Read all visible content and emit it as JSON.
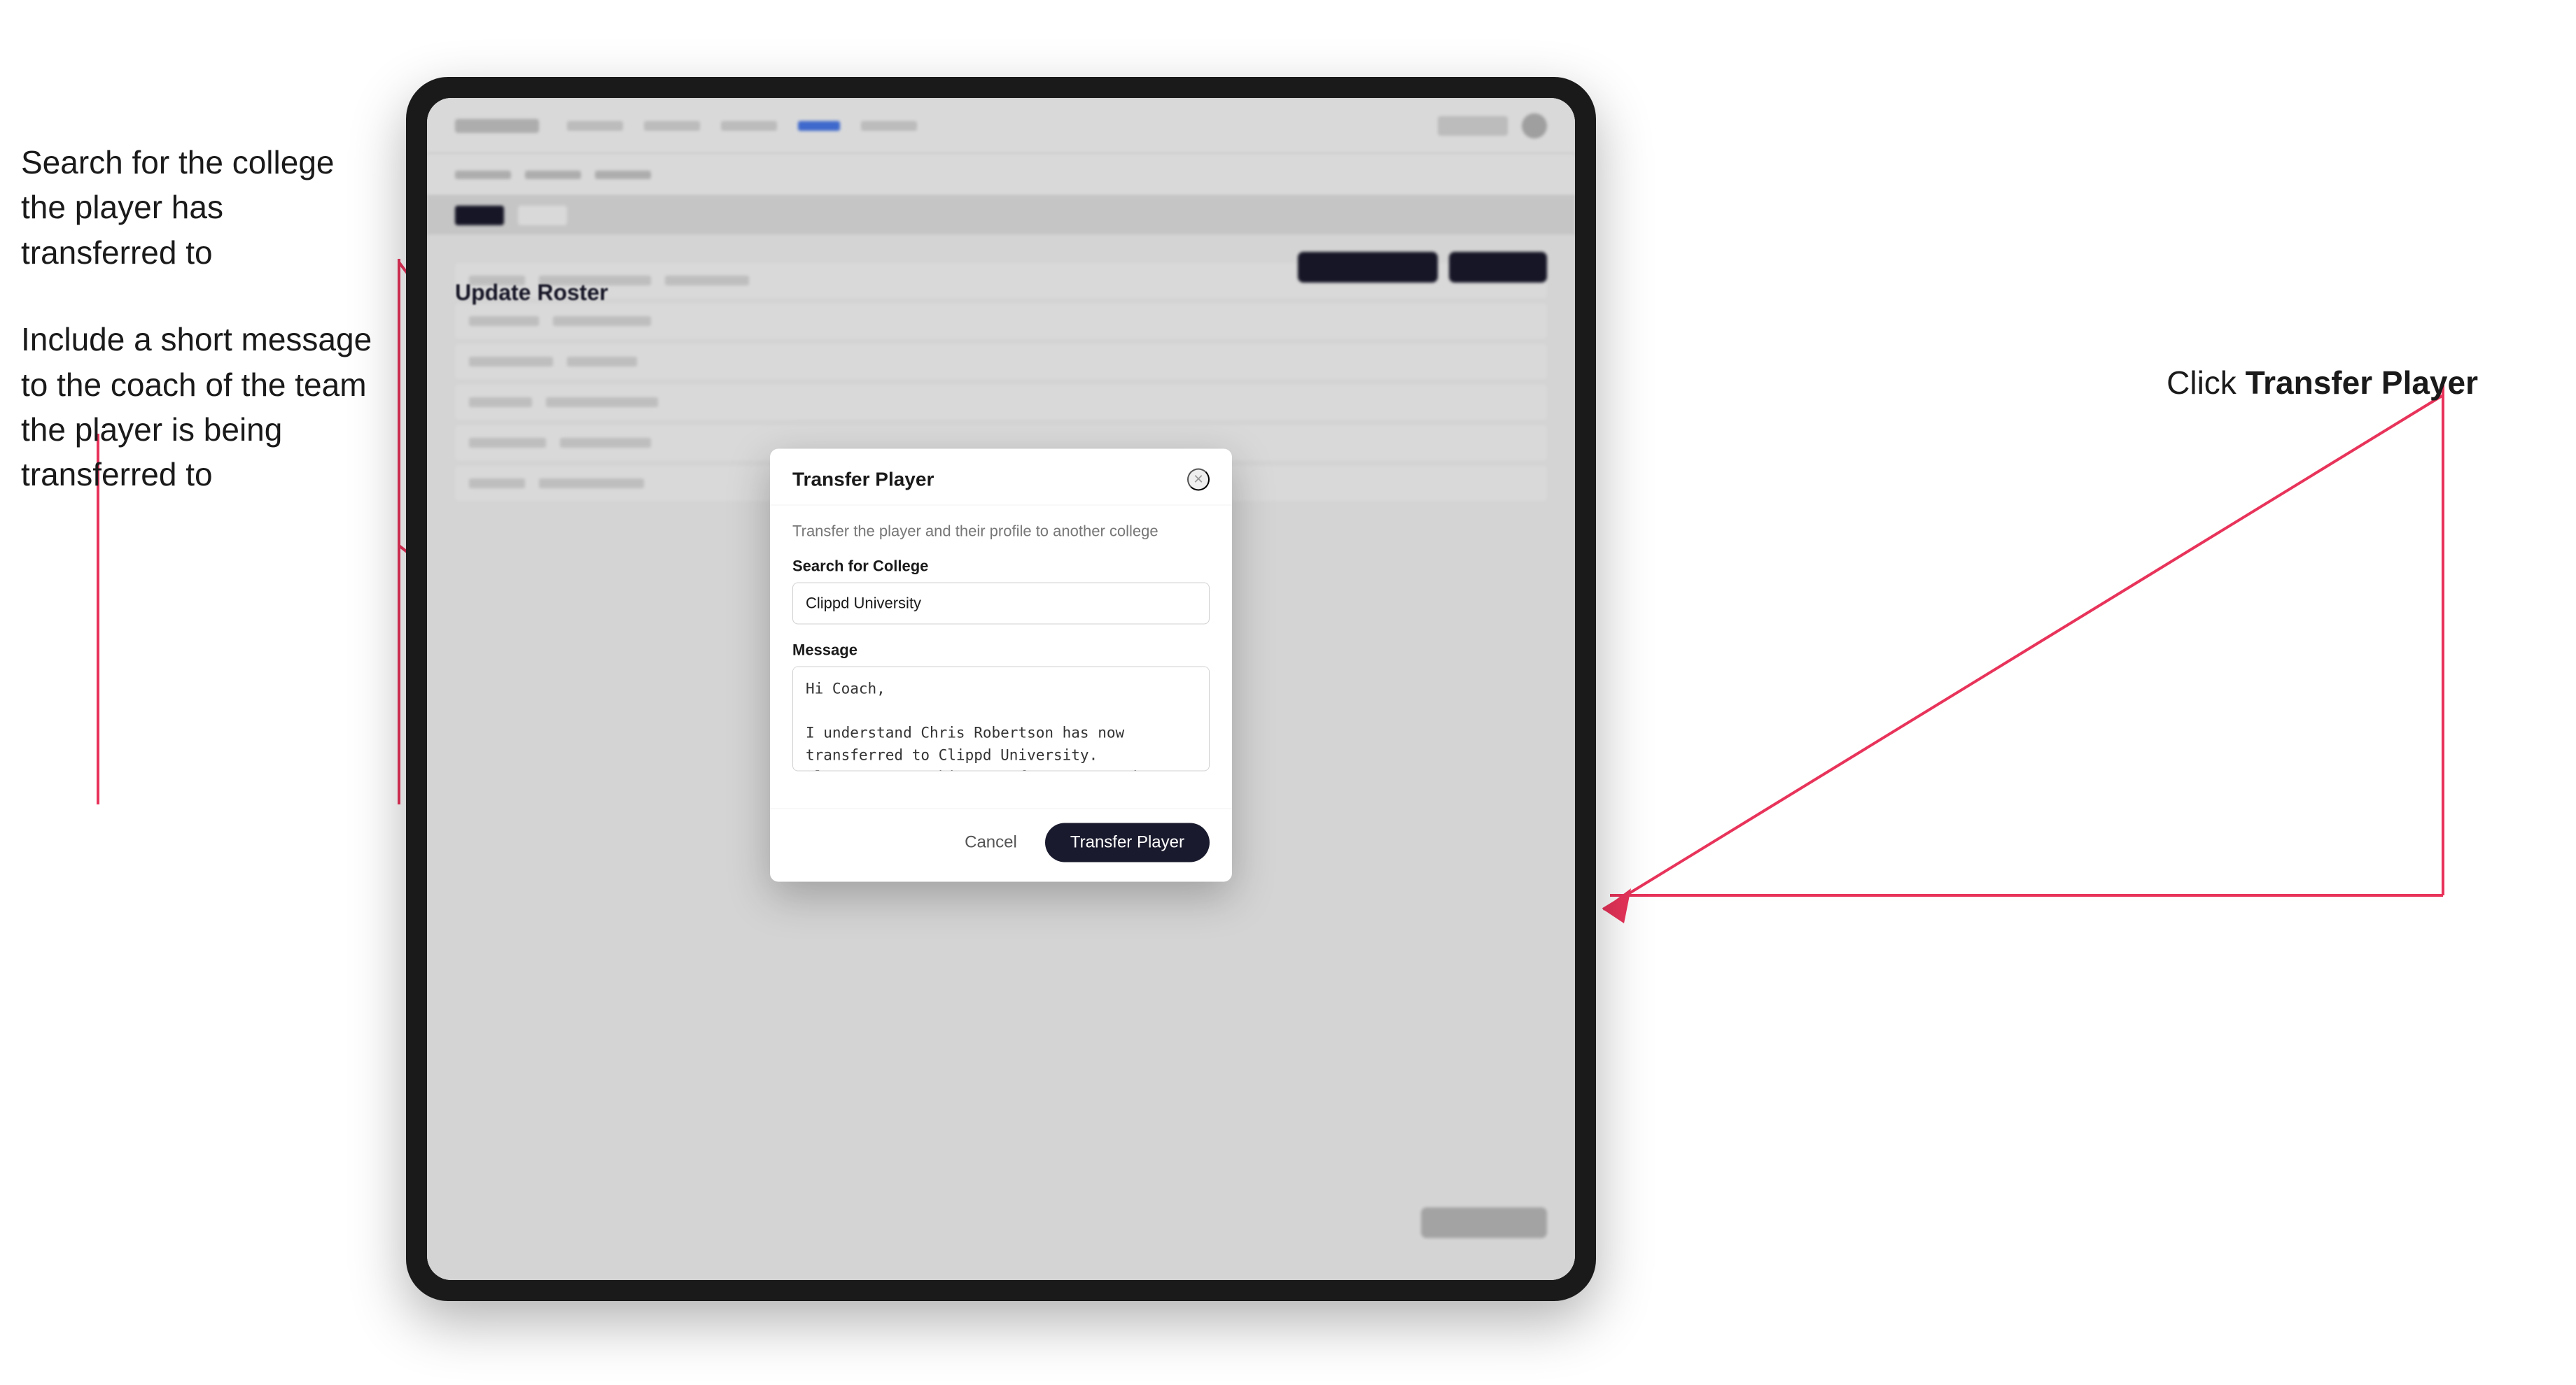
{
  "annotations": {
    "left_top": "Search for the college the player has transferred to",
    "left_bottom": "Include a short message\nto the coach of the team\nthe player is being\ntransferred to",
    "right": "Click ",
    "right_bold": "Transfer Player"
  },
  "modal": {
    "title": "Transfer Player",
    "subtitle": "Transfer the player and their profile to another college",
    "search_label": "Search for College",
    "search_value": "Clippd University",
    "message_label": "Message",
    "message_value": "Hi Coach,\n\nI understand Chris Robertson has now transferred to Clippd University.\nPlease accept this transfer request when you can.",
    "cancel_label": "Cancel",
    "transfer_label": "Transfer Player"
  },
  "page": {
    "update_roster_label": "Update Roster"
  }
}
